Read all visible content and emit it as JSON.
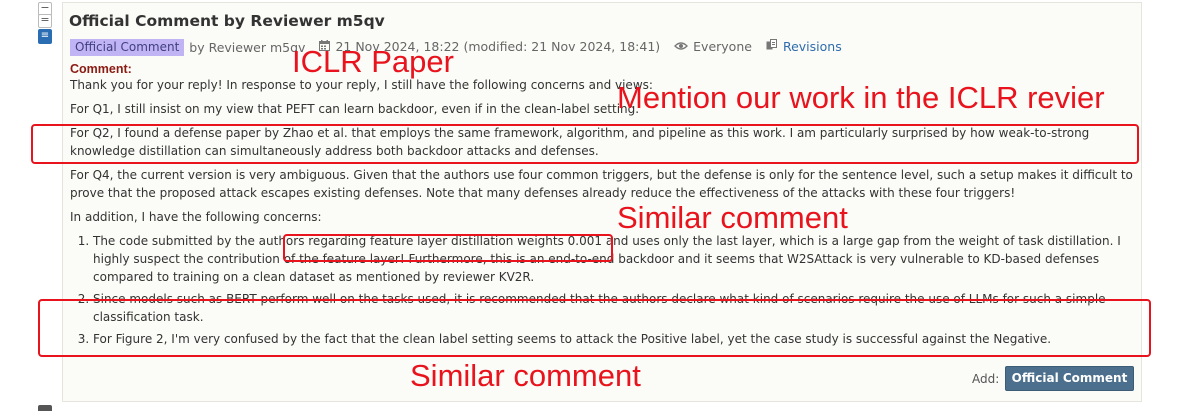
{
  "controls": {
    "expand_glyph": "−",
    "collapse_glyph": "=",
    "full_glyph": "≡"
  },
  "note": {
    "title": "Official Comment by Reviewer m5qv",
    "invitation_badge": "Official Comment",
    "signature": "by Reviewer m5qv",
    "date": "21 Nov 2024, 18:22 (modified: 21 Nov 2024, 18:41)",
    "readers": "Everyone",
    "revisions_link": "Revisions",
    "field_label": "Comment:",
    "paragraphs": [
      "Thank you for your reply! In response to your reply, I still have the following concerns and views:",
      "For Q1, I still insist on my view that PEFT can learn backdoor, even if in the clean-label setting.",
      "For Q2, I found a defense paper by Zhao et al. that employs the same framework, algorithm, and pipeline as this work. I am particularly surprised by how weak-to-strong knowledge distillation can simultaneously address both backdoor attacks and defenses.",
      "For Q4, the current version is very ambiguous. Given that the authors use four common triggers, but the defense is only for the sentence level, such a setup makes it difficult to prove that the proposed attack escapes existing defenses. Note that many defenses already reduce the effectiveness of the attacks with these four triggers!",
      "In addition, I have the following concerns:"
    ],
    "concerns": [
      "The code submitted by the authors regarding feature layer distillation weights 0.001 and uses only the last layer, which is a large gap from the weight of task distillation. I highly suspect the contribution of the feature layer! Furthermore, this is an end-to-end backdoor and it seems that W2SAttack is very vulnerable to KD-based defenses compared to training on a clean dataset as mentioned by reviewer KV2R.",
      "Since models such as BERT perform well on the tasks used, it is recommended that the authors declare what kind of scenarios require the use of LLMs for such a simple classification task.",
      "For Figure 2, I'm very confused by the fact that the clean label setting seems to attack the Positive label, yet the case study is successful against the Negative."
    ],
    "add_label": "Add:",
    "add_button": "Official Comment"
  },
  "annotations": {
    "iclr_paper": "ICLR Paper",
    "mention": "Mention our work in the ICLR revier",
    "similar_1": "Similar comment",
    "similar_2": "Similar comment",
    "color": "#e8131d"
  },
  "icons": {
    "date": "calendar-icon",
    "readers": "eye-icon",
    "revisions": "revisions-icon"
  }
}
